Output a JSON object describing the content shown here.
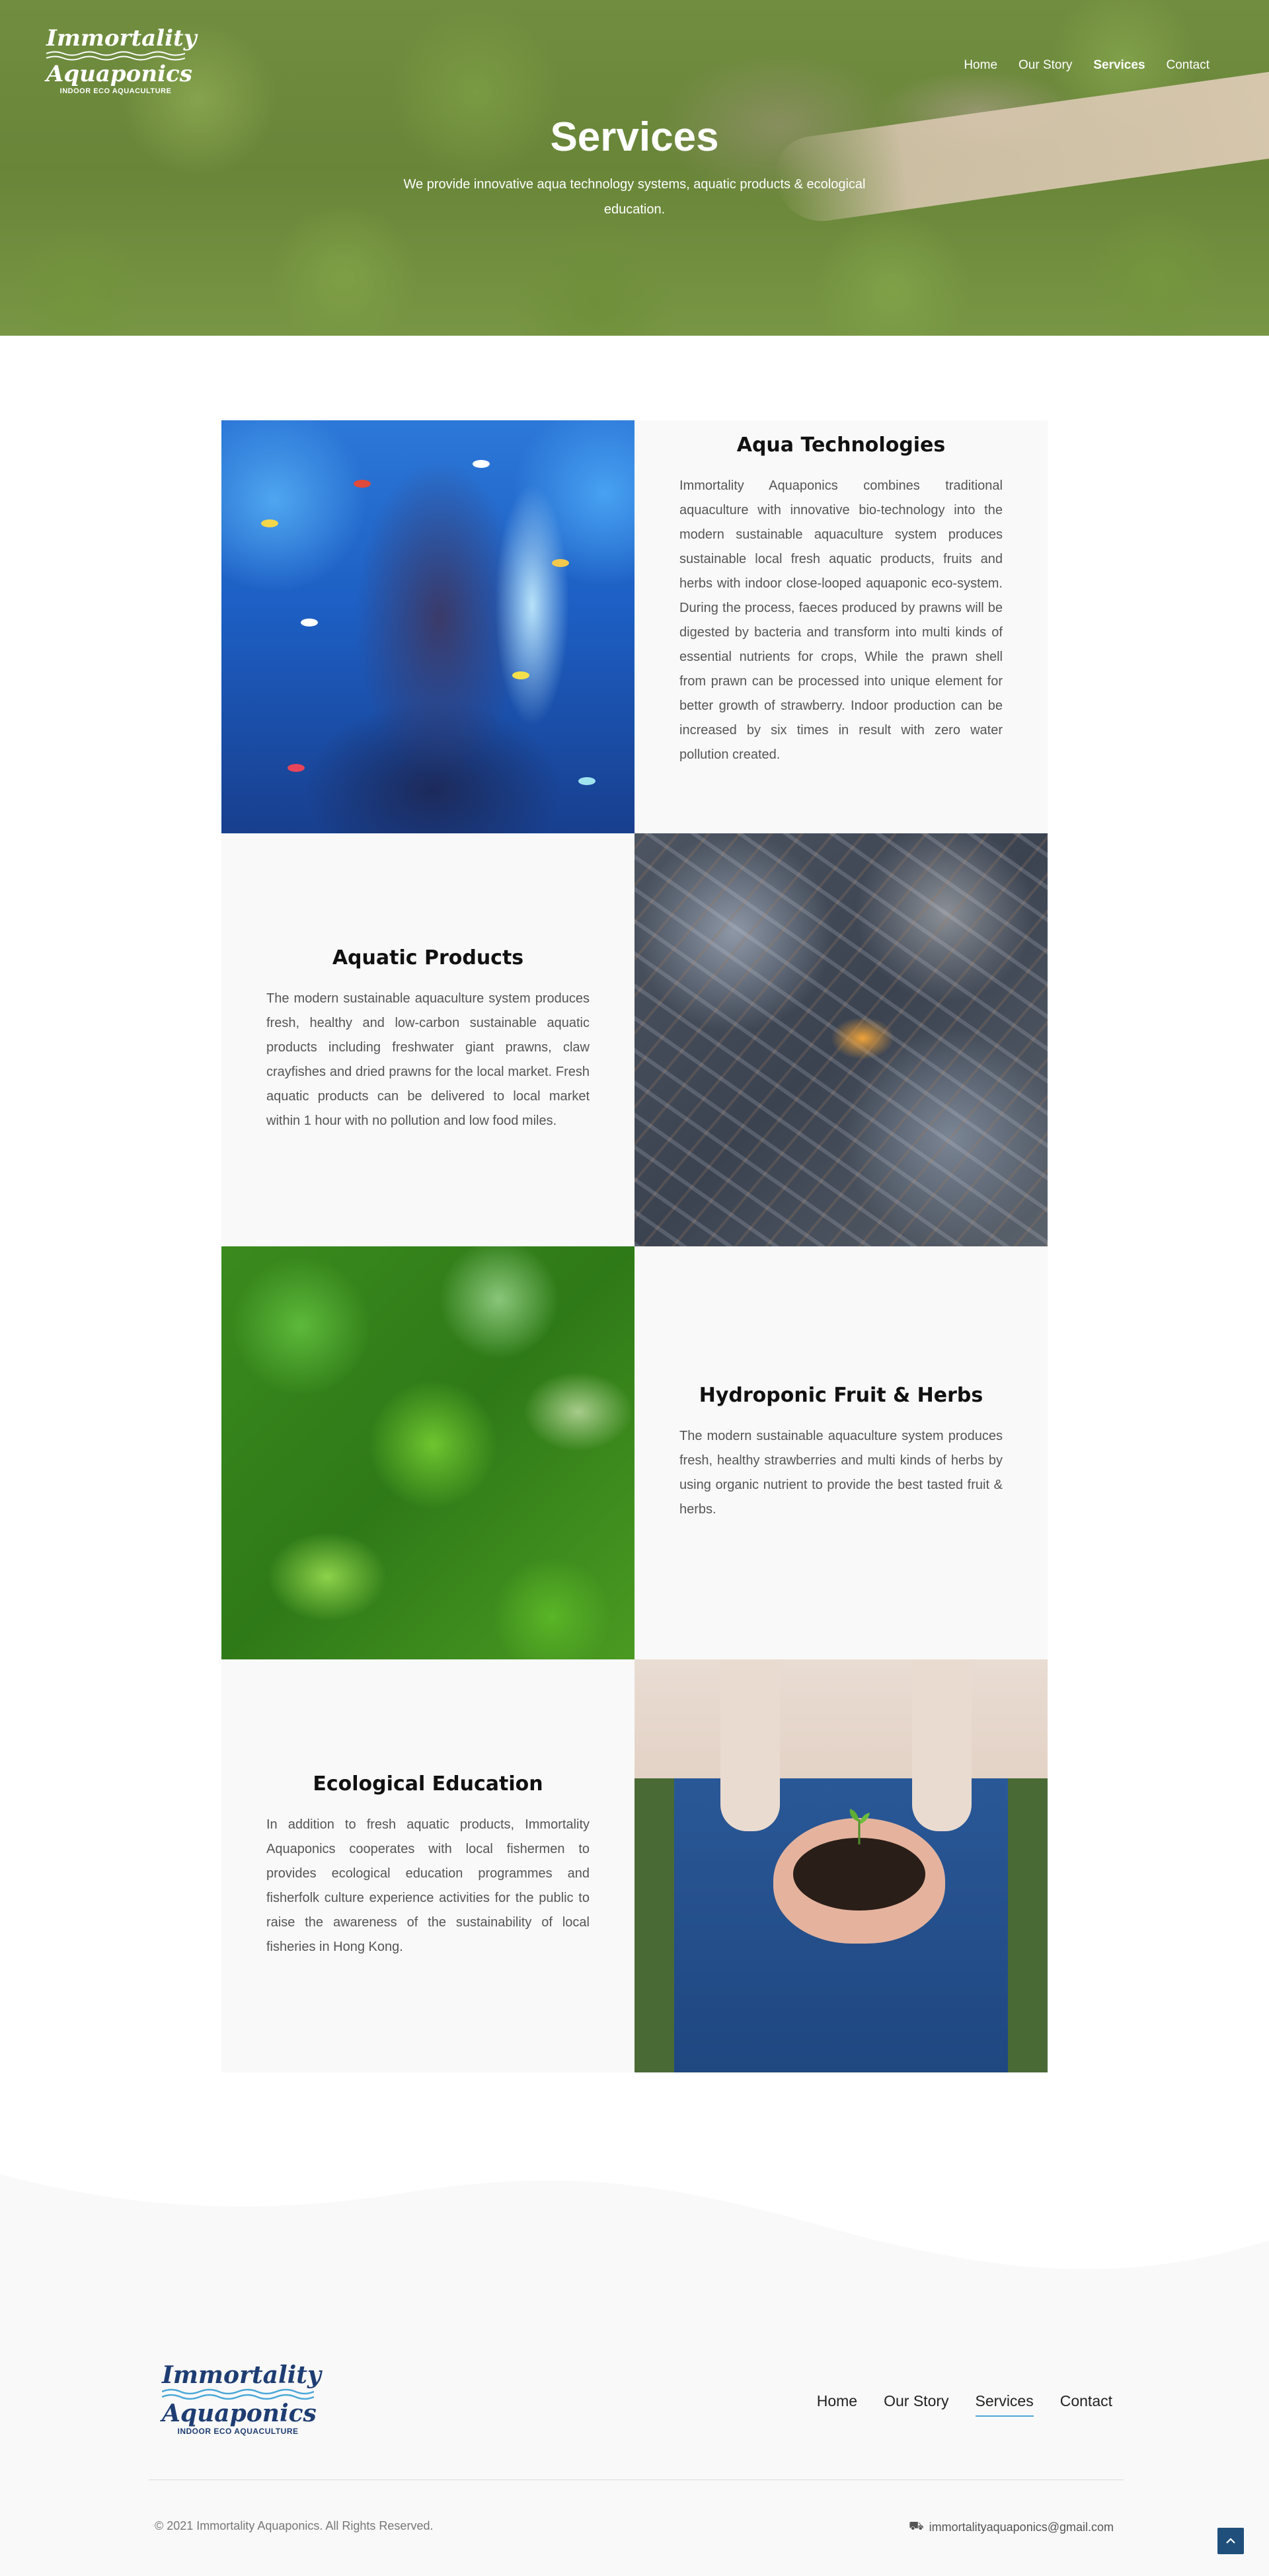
{
  "header": {
    "logo": {
      "line1": "Immortality",
      "line2": "Aquaponics",
      "tagline": "INDOOR ECO AQUACULTURE"
    },
    "nav": [
      {
        "label": "Home"
      },
      {
        "label": "Our Story"
      },
      {
        "label": "Services",
        "active": true
      },
      {
        "label": "Contact"
      }
    ]
  },
  "hero": {
    "title": "Services",
    "subtitle": "We provide innovative aqua technology systems, aquatic products & ecological education."
  },
  "services": [
    {
      "title": "Aqua Technologies",
      "body": "Immortality Aquaponics combines traditional aquaculture with innovative bio-technology into the modern sustainable aquaculture system produces sustainable local fresh aquatic products, fruits and herbs with indoor close-looped aquaponic eco-system. During the process, faeces produced by prawns will be digested by bacteria and transform into multi kinds of essential nutrients for crops, While the prawn shell from prawn can be processed into unique element for better growth of strawberry. Indoor production can be increased by six times in result with zero water pollution created."
    },
    {
      "title": "Aquatic Products",
      "body": "The modern sustainable aquaculture system produces fresh, healthy and low-carbon sustainable aquatic products including freshwater giant prawns, claw crayfishes and dried prawns for the local market. Fresh aquatic products can be delivered to local market within 1 hour with no pollution and low food miles."
    },
    {
      "title": "Hydroponic Fruit & Herbs",
      "body": "The modern sustainable aquaculture system produces fresh, healthy strawberries and multi kinds of herbs by using organic nutrient to provide the best tasted fruit & herbs."
    },
    {
      "title": "Ecological Education",
      "body": "In addition to fresh aquatic products, Immortality Aquaponics cooperates with local fishermen to provides ecological education programmes and fisherfolk culture experience activities for the public to raise the awareness of the sustainability of local fisheries in Hong Kong."
    }
  ],
  "footer": {
    "logo": {
      "line1": "Immortality",
      "line2": "Aquaponics",
      "tagline": "INDOOR ECO AQUACULTURE"
    },
    "nav": [
      {
        "label": "Home"
      },
      {
        "label": "Our Story"
      },
      {
        "label": "Services",
        "active": true
      },
      {
        "label": "Contact"
      }
    ],
    "copyright": "© 2021 Immortality Aquaponics. All Rights Reserved.",
    "email": "immortalityaquaponics@gmail.com",
    "email_icon": "truck-icon",
    "back_to_top_icon": "chevron-up-icon"
  },
  "colors": {
    "accent": "#4aa8d8",
    "logo_navy": "#1e3d72",
    "back_to_top": "#1f4f7a",
    "panel_bg": "#f9f9f9"
  }
}
